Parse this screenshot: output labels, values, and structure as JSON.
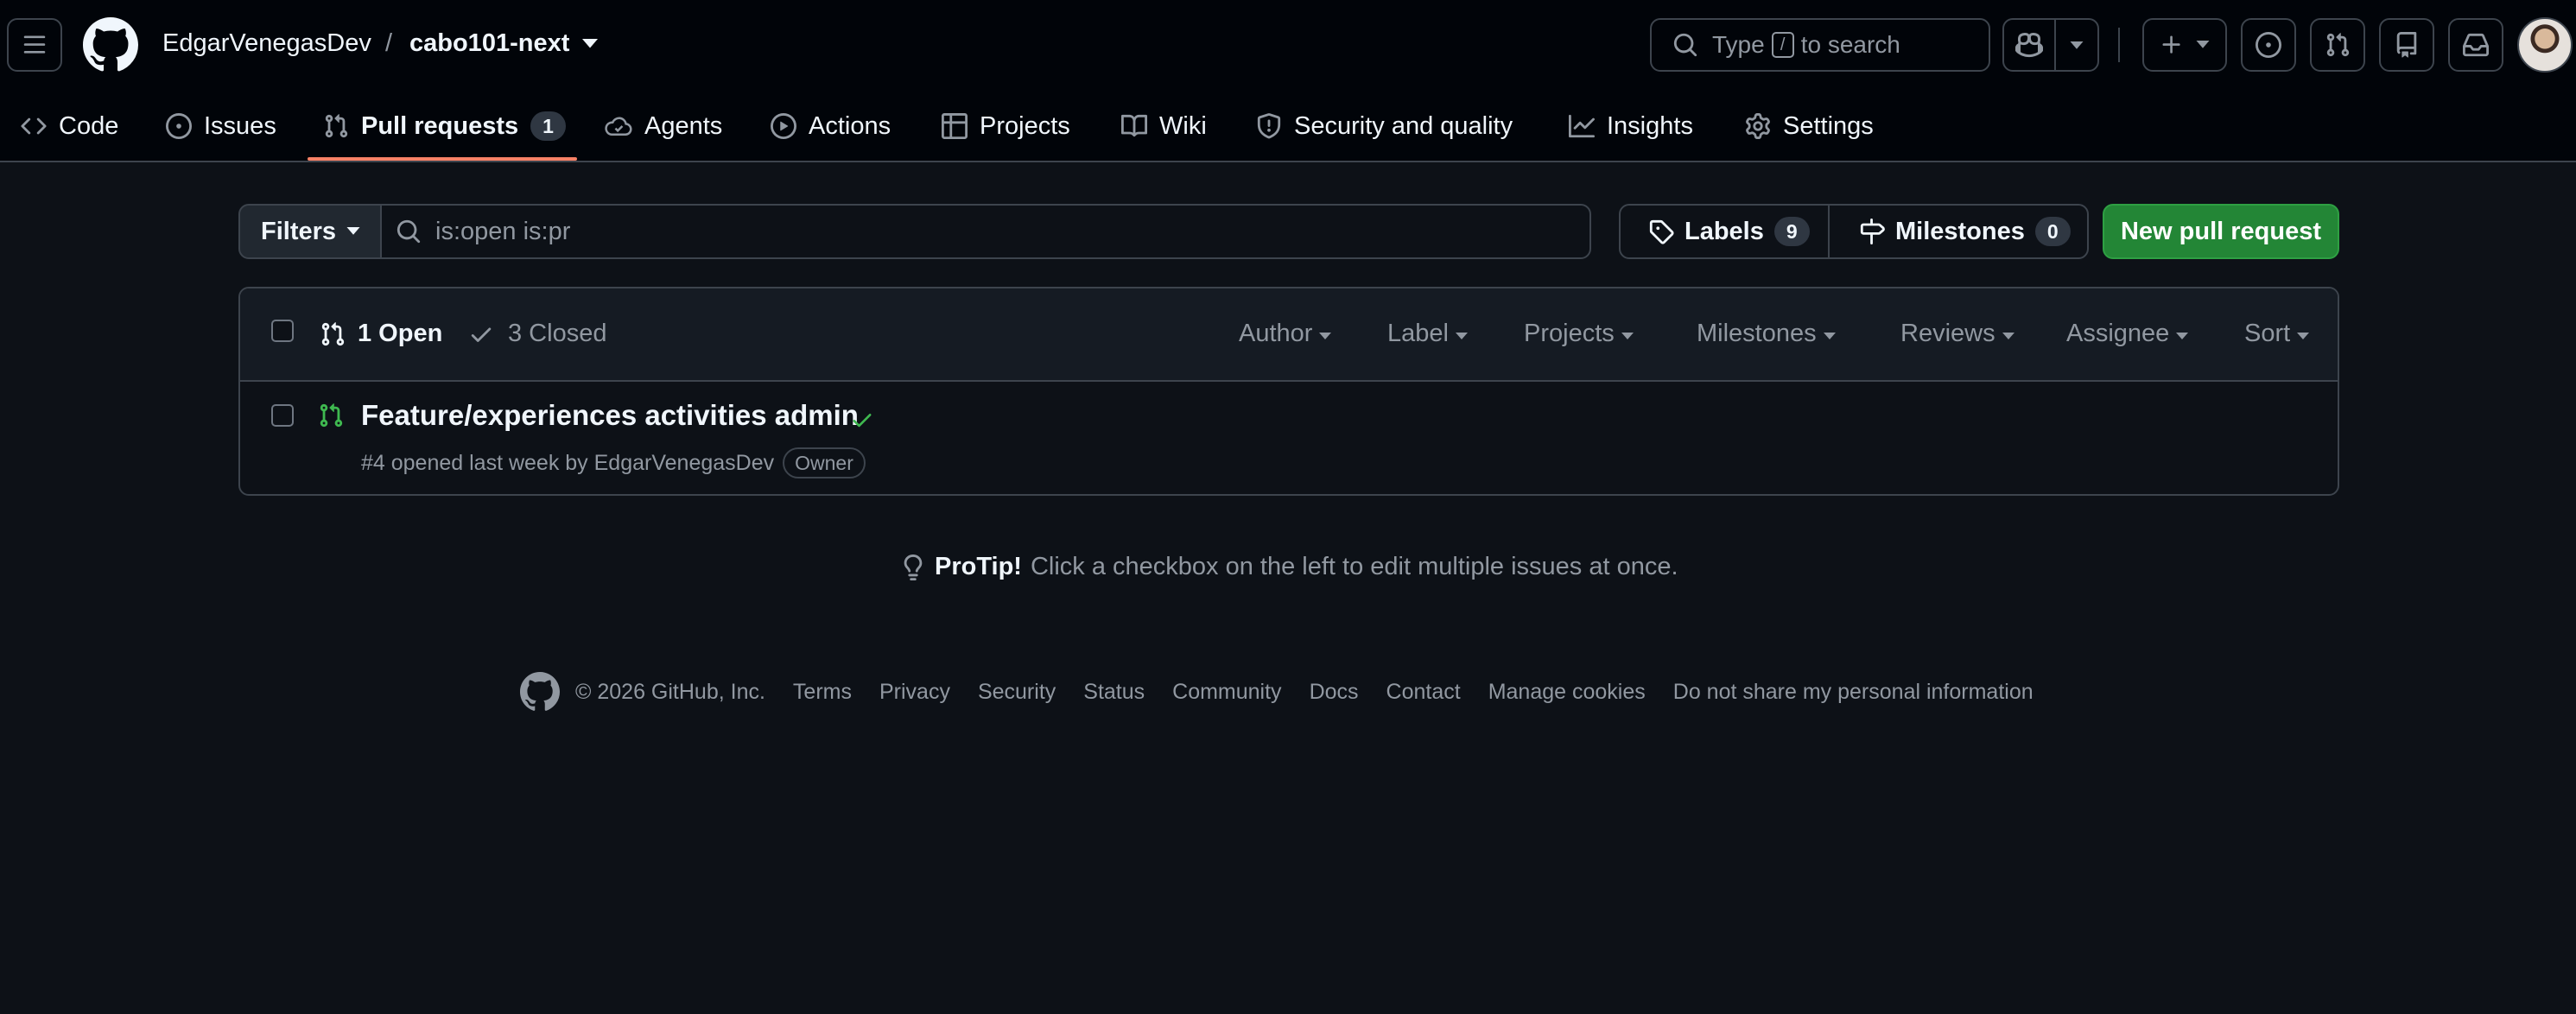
{
  "header": {
    "owner": "EdgarVenegasDev",
    "separator": "/",
    "repo": "cabo101-next",
    "search_prefix": "Type",
    "search_key": "/",
    "search_suffix": "to search"
  },
  "tabs": [
    {
      "label": "Code",
      "icon": "code-icon"
    },
    {
      "label": "Issues",
      "icon": "issue-opened-icon"
    },
    {
      "label": "Pull requests",
      "icon": "git-pull-request-icon",
      "count": "1",
      "active": true
    },
    {
      "label": "Agents",
      "icon": "agent-icon"
    },
    {
      "label": "Actions",
      "icon": "play-icon"
    },
    {
      "label": "Projects",
      "icon": "table-icon"
    },
    {
      "label": "Wiki",
      "icon": "book-icon"
    },
    {
      "label": "Security and quality",
      "icon": "shield-icon"
    },
    {
      "label": "Insights",
      "icon": "graph-icon"
    },
    {
      "label": "Settings",
      "icon": "gear-icon"
    }
  ],
  "subnav": {
    "filters_label": "Filters",
    "filter_value": "is:open is:pr",
    "labels_label": "Labels",
    "labels_count": "9",
    "milestones_label": "Milestones",
    "milestones_count": "0",
    "new_pr_label": "New pull request"
  },
  "list": {
    "open_label": "1 Open",
    "closed_label": "3 Closed",
    "filters": [
      "Author",
      "Label",
      "Projects",
      "Milestones",
      "Reviews",
      "Assignee",
      "Sort"
    ],
    "items": [
      {
        "title": "Feature/experiences activities admin",
        "meta": "#4 opened last week by EdgarVenegasDev",
        "badge": "Owner",
        "status": "success"
      }
    ]
  },
  "protip": {
    "label": "ProTip!",
    "text": "Click a checkbox on the left to edit multiple issues at once."
  },
  "footer": {
    "copyright": "© 2026 GitHub, Inc.",
    "links": [
      "Terms",
      "Privacy",
      "Security",
      "Status",
      "Community",
      "Docs",
      "Contact",
      "Manage cookies",
      "Do not share my personal information"
    ]
  },
  "colors": {
    "background": "#0d1117",
    "header_bg": "#010409",
    "accent_underline": "#f78166",
    "primary_button": "#238636",
    "open_icon": "#3fb950",
    "muted_text": "#9198a1"
  }
}
